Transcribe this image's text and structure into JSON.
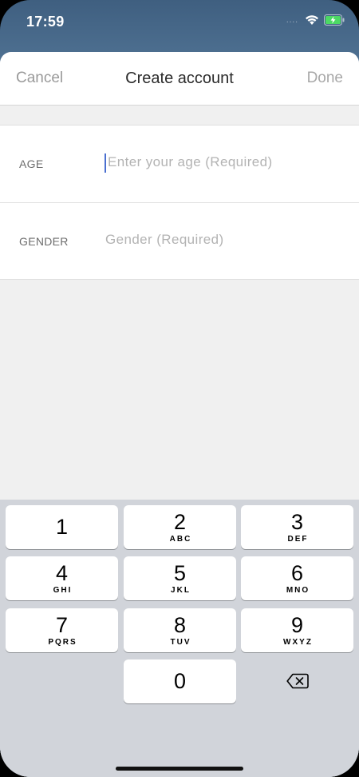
{
  "status_bar": {
    "time": "17:59",
    "signal": "....",
    "wifi_icon": "wifi-icon",
    "battery_icon": "battery-charging-icon"
  },
  "nav": {
    "cancel": "Cancel",
    "title": "Create account",
    "done": "Done"
  },
  "form": {
    "rows": [
      {
        "label": "AGE",
        "placeholder": "Enter your age (Required)"
      },
      {
        "label": "GENDER",
        "placeholder": "Gender (Required)"
      }
    ]
  },
  "keyboard": {
    "keys": [
      {
        "digit": "1",
        "letters": ""
      },
      {
        "digit": "2",
        "letters": "ABC"
      },
      {
        "digit": "3",
        "letters": "DEF"
      },
      {
        "digit": "4",
        "letters": "GHI"
      },
      {
        "digit": "5",
        "letters": "JKL"
      },
      {
        "digit": "6",
        "letters": "MNO"
      },
      {
        "digit": "7",
        "letters": "PQRS"
      },
      {
        "digit": "8",
        "letters": "TUV"
      },
      {
        "digit": "9",
        "letters": "WXYZ"
      },
      {
        "digit": "0",
        "letters": ""
      }
    ],
    "delete_icon": "backspace-icon"
  },
  "colors": {
    "caret": "#4a6fd0",
    "keyboard_bg": "#d1d4da",
    "header_bg": "#4d6f90"
  }
}
